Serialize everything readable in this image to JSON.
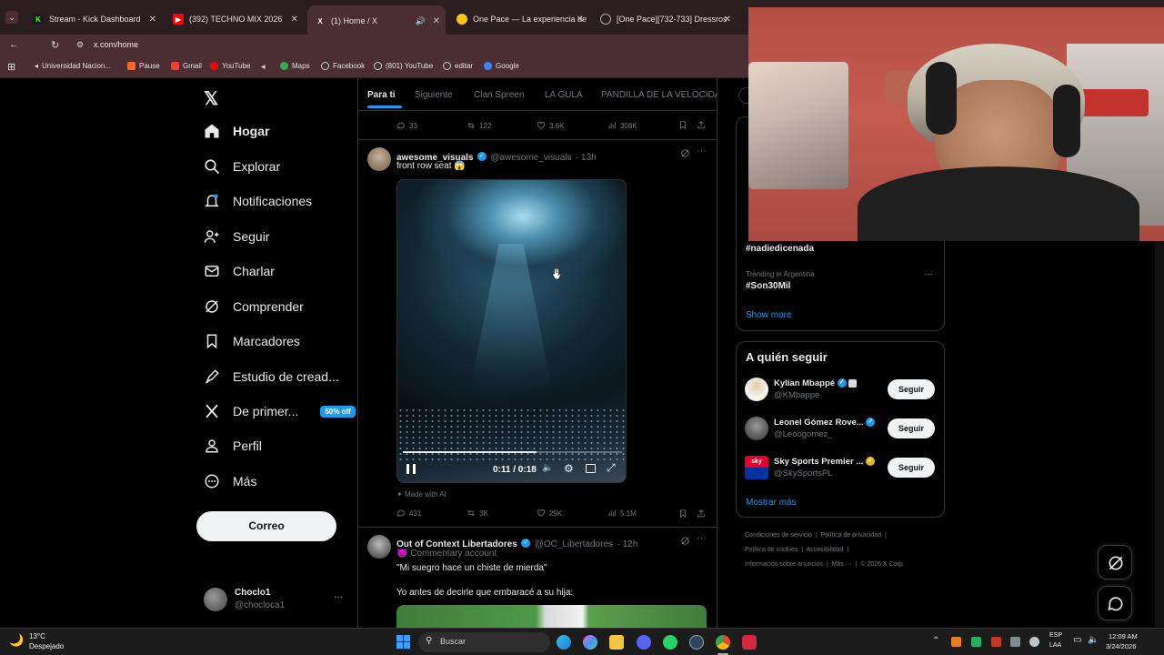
{
  "browser": {
    "tabs": [
      {
        "label": "Stream - Kick Dashboard",
        "favicon": "K",
        "color": "#53fc18"
      },
      {
        "label": "(392) TECHNO MIX 2026",
        "favicon": "▶",
        "color": "#ff0000"
      },
      {
        "label": "(1) Home / X",
        "favicon": "X",
        "color": "#000000"
      },
      {
        "label": "One Pace — La experiencia de",
        "favicon": "●",
        "color": "#f5c518"
      },
      {
        "label": "[One Pace][732-733] Dressros",
        "favicon": "◎",
        "color": "#888888"
      }
    ],
    "url": "x.com/home",
    "bookmarks": [
      "Universidad Nacion...",
      "Pause",
      "Gmail",
      "YouTube",
      "Maps",
      "Facebook",
      "(801) YouTube",
      "editar",
      "Google"
    ]
  },
  "nav": {
    "items": [
      "Hogar",
      "Explorar",
      "Notificaciones",
      "Seguir",
      "Charlar",
      "Comprender",
      "Marcadores",
      "Estudio de cread...",
      "De primer...",
      "Perfil",
      "Más"
    ],
    "premium_badge": "50% off",
    "post_button": "Correo",
    "account_name": "Choclo1",
    "account_handle": "@chocloca1",
    "more": "···"
  },
  "feed": {
    "tabs": [
      "Para ti",
      "Siguiente",
      "Clan Spreen",
      "LA GULA",
      "PANDILLA DE LA VELOCIDA"
    ],
    "top_actions": {
      "replies": "33",
      "reposts": "122",
      "likes": "3.6K",
      "views": "308K"
    },
    "tweet1": {
      "name": "awesome_visuals",
      "handle": "@awesome_visuals",
      "time": "· 13h",
      "text": "front row seat 😱",
      "video_time": "0:11 / 0:18",
      "video_progress": 0.61,
      "made_with_ai": "Made with AI",
      "replies": "431",
      "reposts": "3K",
      "likes": "29K",
      "views": "5.1M"
    },
    "tweet2": {
      "name": "Out of Context Libertadores",
      "handle": "@OC_Libertadores",
      "time": "· 12h",
      "label": "Commentary account",
      "line1": "\"Mi suegro hace un chiste de mierda\"",
      "line2": "Yo antes de decirle que embaracé a su hija:"
    }
  },
  "right": {
    "trend1_tag": "#nadiedicenada",
    "trend2_context": "Trending in Argentina",
    "trend2_tag": "#Son30Mil",
    "show_more": "Show more",
    "who_to_follow_title": "A quién seguir",
    "follow_label": "Seguir",
    "suggestions": [
      {
        "name": "Kylian Mbappé",
        "handle": "@KMbappe"
      },
      {
        "name": "Leonel Gómez Rove...",
        "handle": "@Leoogomez_"
      },
      {
        "name": "Sky Sports Premier ...",
        "handle": "@SkySportsPL"
      }
    ],
    "show_more_follow": "Mostrar más",
    "footer": [
      "Condiciones de servicio",
      "Política de privacidad",
      "Política de cookies",
      "Accesibilidad",
      "Información sobre anuncios",
      "Más ···",
      "© 2026 X Corp."
    ]
  },
  "taskbar": {
    "temp": "13°C",
    "weather": "Despejado",
    "search": "Buscar",
    "lang1": "ESP",
    "lang2": "LAA",
    "time": "12:09 AM",
    "date": "3/24/2026"
  }
}
